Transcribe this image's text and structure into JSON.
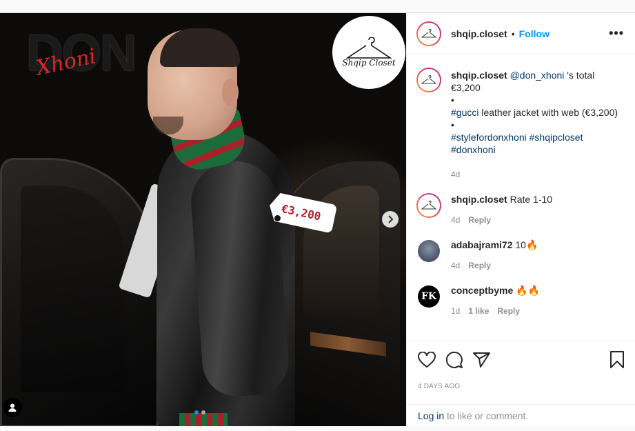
{
  "media": {
    "logo_don": "DON",
    "logo_xhoni": "Xhoni",
    "brand_badge": "Shqip Closet",
    "price_tag": "€3,200"
  },
  "header": {
    "username": "shqip.closet",
    "separator": "•",
    "follow_label": "Follow",
    "more_label": "•••"
  },
  "caption": {
    "username": "shqip.closet",
    "mention": "@don_xhoni",
    "line1_text": " 's total €3,200",
    "bullet1": "•",
    "hashtag_gucci": "#gucci",
    "line2_text": " leather jacket with web (€3,200)",
    "bullet2": "•",
    "hashtag_style": "#stylefordonxhoni",
    "hashtag_shqip": "#shqipcloset",
    "hashtag_don": "#donxhoni",
    "time": "4d"
  },
  "comments": [
    {
      "username": "shqip.closet",
      "text": "Rate 1-10",
      "time": "4d",
      "reply": "Reply"
    },
    {
      "username": "adabajrami72",
      "text": "10",
      "emoji": "🔥",
      "time": "4d",
      "reply": "Reply"
    },
    {
      "username": "conceptbyme",
      "text": "",
      "emoji": "🔥🔥",
      "time": "1d",
      "likes": "1 like",
      "reply": "Reply",
      "avatar_initials": "FK"
    }
  ],
  "actions": {
    "date": "4 DAYS AGO",
    "login_link": "Log in",
    "login_text": " to like or comment."
  },
  "colors": {
    "link_blue": "#0095f6",
    "hashtag": "#00376b",
    "muted": "#8e8e8e"
  }
}
